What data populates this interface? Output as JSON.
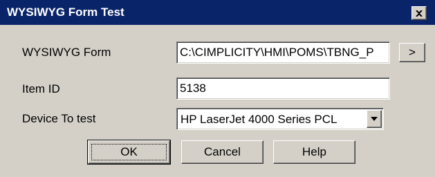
{
  "window": {
    "title": "WYSIWYG Form Test",
    "close_icon": "close-icon"
  },
  "form": {
    "wysiwyg_form_label": "WYSIWYG Form",
    "wysiwyg_form_value": "C:\\CIMPLICITY\\HMI\\POMS\\TBNG_P",
    "browse_label": ">",
    "item_id_label": "Item ID",
    "item_id_value": "5138",
    "device_label": "Device To test",
    "device_value": "HP LaserJet 4000 Series PCL",
    "device_dropdown_icon": "chevron-down-icon"
  },
  "buttons": {
    "ok": "OK",
    "cancel": "Cancel",
    "help": "Help"
  }
}
